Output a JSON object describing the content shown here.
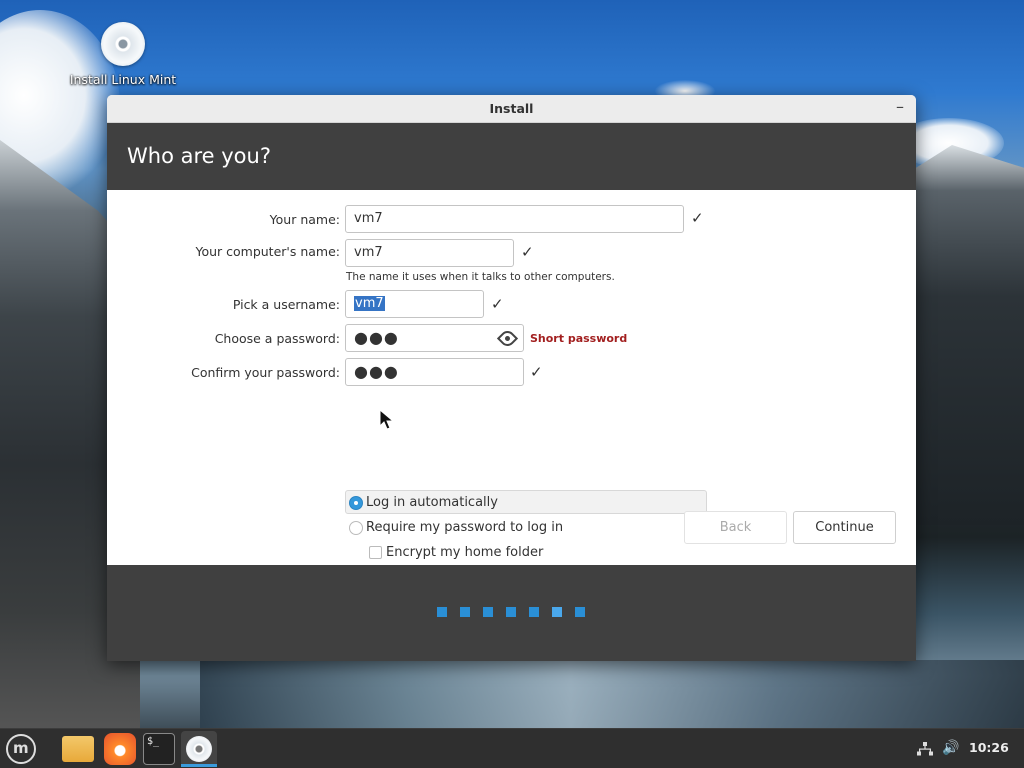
{
  "desktop": {
    "icon_label": "Install Linux Mint"
  },
  "window": {
    "title": "Install",
    "minimize_glyph": "–",
    "header": "Who are you?"
  },
  "form": {
    "your_name": {
      "label": "Your name:",
      "value": "vm7"
    },
    "computer_name": {
      "label": "Your computer's name:",
      "value": "vm7",
      "hint": "The name it uses when it talks to other computers."
    },
    "username": {
      "label": "Pick a username:",
      "value": "vm7"
    },
    "password": {
      "label": "Choose a password:",
      "value": "●●●",
      "warning": "Short password"
    },
    "confirm_password": {
      "label": "Confirm your password:",
      "value": "●●●"
    },
    "check_glyph": "✓"
  },
  "options": {
    "login_auto": {
      "label": "Log in automatically",
      "selected": true
    },
    "require_password": {
      "label": "Require my password to log in",
      "selected": false
    },
    "encrypt_home": {
      "label": "Encrypt my home folder",
      "checked": false
    }
  },
  "buttons": {
    "back": "Back",
    "continue": "Continue"
  },
  "progress": {
    "total_steps": 7,
    "current_step": 6
  },
  "taskbar": {
    "menu_glyph": "m",
    "terminal_glyph": "$_",
    "volume_glyph": "🔊",
    "clock": "10:26"
  },
  "colors": {
    "header_bg": "#404040",
    "accent": "#3498db",
    "warning": "#a21f1f",
    "selection": "#3574c5"
  }
}
